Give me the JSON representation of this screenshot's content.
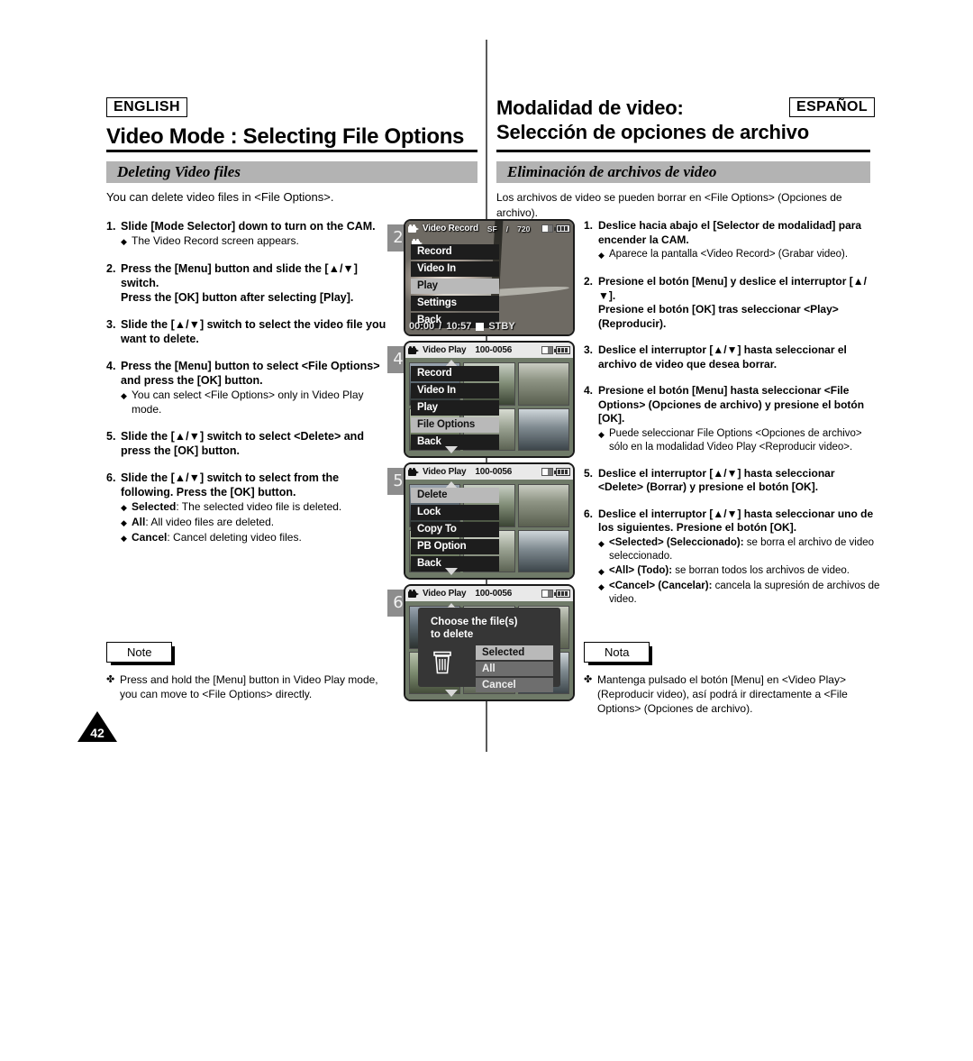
{
  "header": {
    "english_tag": "ENGLISH",
    "english_title": "Video Mode : Selecting File Options",
    "spanish_tag": "ESPAÑOL",
    "spanish_title_line1": "Modalidad de video:",
    "spanish_title_line2": "Selección de opciones de archivo"
  },
  "section": {
    "english_bar": "Deleting Video files",
    "english_lead": "You can delete video files in <File Options>.",
    "spanish_bar": "Eliminación de archivos de video",
    "spanish_lead": "Los archivos de video se pueden borrar en <File Options> (Opciones de archivo)."
  },
  "english_steps": [
    {
      "num": "1.",
      "text": "Slide [Mode Selector] down to turn on the CAM.",
      "bullets": [
        {
          "mark": "◆",
          "text": "The Video Record screen appears."
        }
      ]
    },
    {
      "num": "2.",
      "text": "Press the [Menu] button and slide the [▲/▼] switch.\nPress the [OK] button after selecting [Play].",
      "bullets": []
    },
    {
      "num": "3.",
      "text": "Slide the [▲/▼] switch to select the video file you want to delete.",
      "bullets": []
    },
    {
      "num": "4.",
      "text": "Press the [Menu] button to select <File Options> and press the [OK] button.",
      "bullets": [
        {
          "mark": "◆",
          "text": "You can select <File Options> only in Video Play mode."
        }
      ]
    },
    {
      "num": "5.",
      "text": "Slide the [▲/▼] switch to select <Delete> and press the [OK] button.",
      "bullets": []
    },
    {
      "num": "6.",
      "text": "Slide the [▲/▼] switch to select from the following. Press the [OK] button.",
      "bullets": [
        {
          "mark": "◆",
          "bold": "Selected",
          "text": ": The selected video file is deleted."
        },
        {
          "mark": "◆",
          "bold": "All",
          "text": ": All video files are deleted."
        },
        {
          "mark": "◆",
          "bold": "Cancel",
          "text": ": Cancel deleting video files."
        }
      ]
    }
  ],
  "spanish_steps": [
    {
      "num": "1.",
      "text": "Deslice hacia abajo el [Selector de modalidad] para encender la CAM.",
      "bullets": [
        {
          "mark": "◆",
          "text": "Aparece la pantalla <Video Record> (Grabar video)."
        }
      ]
    },
    {
      "num": "2.",
      "text": "Presione el botón [Menu] y deslice el interruptor [▲/▼].\nPresione el botón [OK] tras seleccionar <Play> (Reproducir).",
      "bullets": []
    },
    {
      "num": "3.",
      "text": "Deslice el interruptor [▲/▼] hasta seleccionar el archivo de video que desea borrar.",
      "bullets": []
    },
    {
      "num": "4.",
      "text": "Presione el botón [Menu] hasta seleccionar <File Options> (Opciones de archivo) y presione el botón [OK].",
      "bullets": [
        {
          "mark": "◆",
          "text": "Puede seleccionar File Options <Opciones de archivo> sólo en la modalidad Video Play <Reproducir video>."
        }
      ]
    },
    {
      "num": "5.",
      "text": "Deslice el interruptor [▲/▼] hasta seleccionar <Delete> (Borrar) y presione el botón [OK].",
      "bullets": []
    },
    {
      "num": "6.",
      "text": "Deslice el interruptor [▲/▼] hasta seleccionar uno de los siguientes. Presione el botón [OK].",
      "bullets": [
        {
          "mark": "◆",
          "bold": "<Selected> (Seleccionado):",
          "text": " se borra el archivo de video seleccionado."
        },
        {
          "mark": "◆",
          "bold": "<All> (Todo):",
          "text": " se borran todos los archivos de video."
        },
        {
          "mark": "◆",
          "bold": "<Cancel> (Cancelar):",
          "text": " cancela la supresión de archivos de video."
        }
      ]
    }
  ],
  "notes": {
    "english_label": "Note",
    "english_mark": "✤",
    "english_text": "Press and hold the [Menu] button in Video Play mode, you can move to <File Options> directly.",
    "spanish_label": "Nota",
    "spanish_mark": "✤",
    "spanish_text": "Mantenga pulsado el botón [Menu] en <Video Play> (Reproducir video), así podrá ir directamente a <File Options> (Opciones de archivo)."
  },
  "page_number": "42",
  "screens": [
    {
      "badge": "2",
      "title": "Video Record",
      "quality": "SF",
      "separator": "/",
      "resolution": "720",
      "menu": [
        "Record",
        "Video In",
        "Play",
        "Settings",
        "Back"
      ],
      "selected": "Play",
      "time_elapsed": "00:00",
      "time_sep": "/",
      "time_total": "10:57",
      "status": "STBY"
    },
    {
      "badge": "4",
      "title": "Video Play",
      "file": "100-0056",
      "menu": [
        "Record",
        "Video In",
        "Play",
        "File Options",
        "Back"
      ],
      "selected": "File Options"
    },
    {
      "badge": "5",
      "title": "Video Play",
      "file": "100-0056",
      "menu": [
        "Delete",
        "Lock",
        "Copy To",
        "PB Option",
        "Back"
      ],
      "selected": "Delete"
    },
    {
      "badge": "6",
      "title": "Video Play",
      "file": "100-0056",
      "dialog_line1": "Choose the file(s)",
      "dialog_line2": "to delete",
      "options": [
        "Selected",
        "All",
        "Cancel"
      ],
      "selected_option": "Selected"
    }
  ]
}
